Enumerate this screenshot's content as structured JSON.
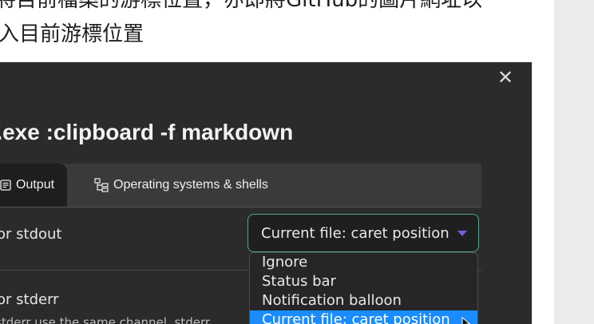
{
  "page": {
    "line1": "將目前檔案的游標位置，亦即將GitHub的圖片網址以",
    "line2": "入目前游標位置"
  },
  "dialog": {
    "title": "t.exe :clipboard -f markdown",
    "close_glyph": "✕",
    "tabs": [
      {
        "label": "Output",
        "icon": "document-lines-icon",
        "active": true
      },
      {
        "label": "Operating systems & shells",
        "icon": "tree-hierarchy-icon",
        "active": false
      }
    ],
    "rows": [
      {
        "label": "or stdout"
      },
      {
        "label": "or stderr",
        "sub": "stderr use the same channel, stderr"
      }
    ],
    "select": {
      "value": "Current file: caret position",
      "caret_color": "#6d63d9",
      "border_color": "#4fa59a"
    },
    "options": [
      {
        "label": "Ignore"
      },
      {
        "label": "Status bar"
      },
      {
        "label": "Notification balloon"
      },
      {
        "label": "Current file: caret position",
        "selected": true
      }
    ],
    "highlight_color": "#1a8cff"
  }
}
